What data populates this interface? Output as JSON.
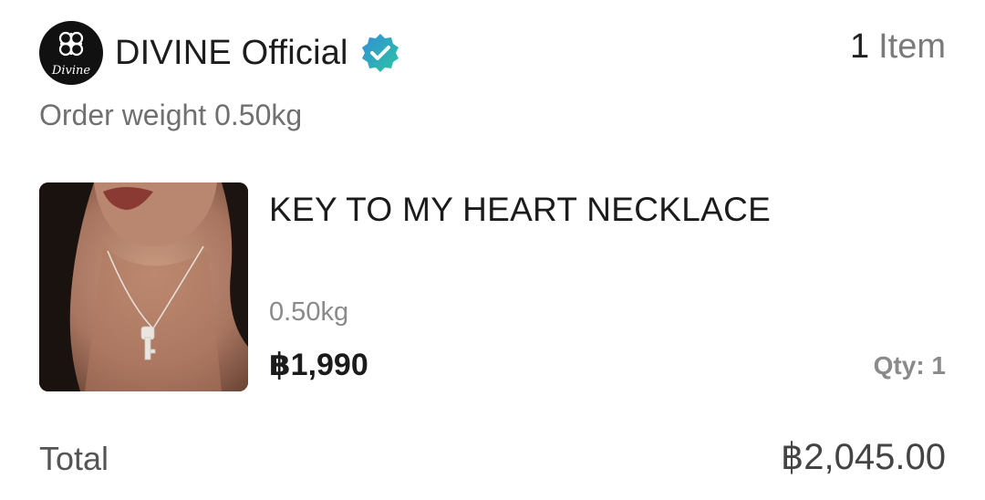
{
  "store": {
    "name": "DIVINE Official",
    "logo_text": "Divine",
    "logo_icon": "divine-logo-icon",
    "verified_icon": "verified-badge-icon",
    "verified_colors": [
      "#2ec4a0",
      "#2f8fd8"
    ]
  },
  "header": {
    "item_count": "1",
    "item_word": "Item"
  },
  "order": {
    "weight_text": "Order weight 0.50kg"
  },
  "product": {
    "title": "KEY TO MY HEART NECKLACE",
    "weight": "0.50kg",
    "price": "฿1,990",
    "qty": "Qty: 1",
    "image_icon": "product-photo"
  },
  "total": {
    "label": "Total",
    "value": "฿2,045.00"
  }
}
